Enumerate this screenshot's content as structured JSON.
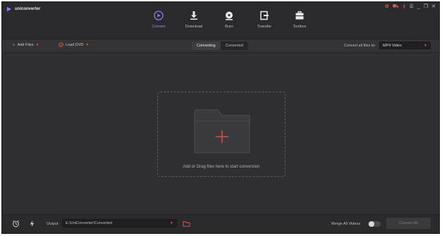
{
  "app": {
    "title": "uniconverter"
  },
  "window_controls": [
    "gift-icon",
    "cart-icon",
    "key-icon",
    "menu-icon",
    "minimize-icon",
    "restore-icon",
    "close-icon"
  ],
  "nav": {
    "items": [
      {
        "label": "Convert",
        "icon": "convert-icon",
        "active": true
      },
      {
        "label": "Download",
        "icon": "download-icon",
        "active": false
      },
      {
        "label": "Burn",
        "icon": "burn-icon",
        "active": false
      },
      {
        "label": "Transfer",
        "icon": "transfer-icon",
        "active": false
      },
      {
        "label": "Toolbox",
        "icon": "toolbox-icon",
        "active": false
      }
    ]
  },
  "toolbar": {
    "add_files": "Add Files",
    "load_dvd": "Load DVD",
    "tabs": [
      {
        "label": "Converting",
        "active": true
      },
      {
        "label": "Converted",
        "active": false
      }
    ],
    "convert_all_label": "Convert all files to:",
    "format_value": "MP4 Video"
  },
  "dropzone": {
    "text": "Add or Drag files here to start conversion"
  },
  "bottom": {
    "output_label": "Output",
    "output_path": "E:\\UniConverter\\Converted",
    "merge_label": "Merge All Videos",
    "merge_on": false,
    "convert_all_button": "Convert All"
  },
  "colors": {
    "accent": "#7b6cf0",
    "plus_red": "#e5574b",
    "bg": "#2f2f31"
  }
}
